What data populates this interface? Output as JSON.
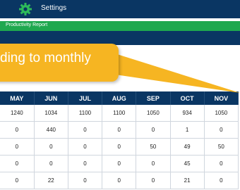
{
  "header": {
    "settings_label": "Settings",
    "gear_icon": "gear-icon",
    "accent": "#2dbb5a"
  },
  "subheader": {
    "report_label": "Productivity Report"
  },
  "callout": {
    "text": "ding to monthly",
    "color": "#f6b522"
  },
  "table": {
    "columns": [
      "MAY",
      "JUN",
      "JUL",
      "AUG",
      "SEP",
      "OCT",
      "NOV"
    ],
    "rows": [
      [
        "1240",
        "1034",
        "1100",
        "1100",
        "1050",
        "934",
        "1050"
      ],
      [
        "0",
        "440",
        "0",
        "0",
        "0",
        "1",
        "0"
      ],
      [
        "0",
        "0",
        "0",
        "0",
        "50",
        "49",
        "50"
      ],
      [
        "0",
        "0",
        "0",
        "0",
        "0",
        "45",
        "0"
      ],
      [
        "0",
        "22",
        "0",
        "0",
        "0",
        "21",
        "0"
      ]
    ]
  }
}
